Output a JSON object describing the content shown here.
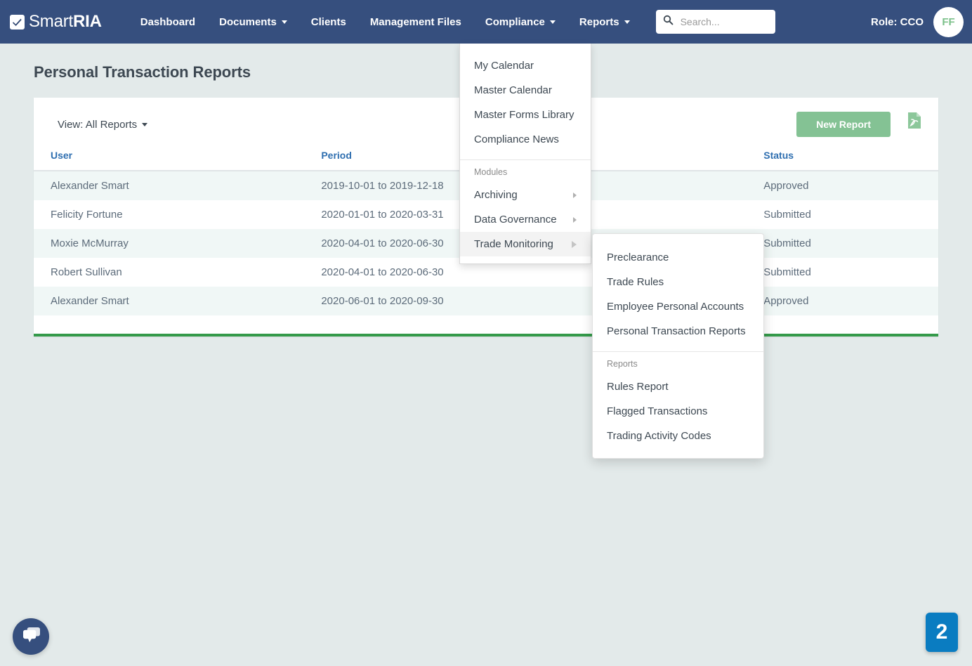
{
  "navbar": {
    "brand": {
      "thin": "Smart",
      "bold": "RIA",
      "icon": "checkbox-check-icon"
    },
    "items": [
      {
        "label": "Dashboard",
        "has_caret": false,
        "name": "nav-link-dashboard"
      },
      {
        "label": "Documents",
        "has_caret": true,
        "name": "nav-link-documents"
      },
      {
        "label": "Clients",
        "has_caret": false,
        "name": "nav-link-clients"
      },
      {
        "label": "Management Files",
        "has_caret": false,
        "name": "nav-link-management-files"
      },
      {
        "label": "Compliance",
        "has_caret": true,
        "name": "nav-link-compliance"
      },
      {
        "label": "Reports",
        "has_caret": true,
        "name": "nav-link-reports"
      }
    ],
    "search": {
      "placeholder": "Search...",
      "value": "",
      "icon": "search-icon"
    },
    "role": "Role: CCO",
    "avatar_initials": "FF"
  },
  "compliance_menu": {
    "items": [
      {
        "label": "My Calendar"
      },
      {
        "label": "Master Calendar"
      },
      {
        "label": "Master Forms Library"
      },
      {
        "label": "Compliance News"
      }
    ],
    "modules_header": "Modules",
    "modules": [
      {
        "label": "Archiving",
        "submenu": true,
        "active": false
      },
      {
        "label": "Data Governance",
        "submenu": true,
        "active": false
      },
      {
        "label": "Trade Monitoring",
        "submenu": true,
        "active": true
      }
    ]
  },
  "trade_submenu": {
    "items": [
      {
        "label": "Preclearance"
      },
      {
        "label": "Trade Rules"
      },
      {
        "label": "Employee Personal Accounts"
      },
      {
        "label": "Personal Transaction Reports"
      }
    ],
    "reports_header": "Reports",
    "reports": [
      {
        "label": "Rules Report"
      },
      {
        "label": "Flagged Transactions"
      },
      {
        "label": "Trading Activity Codes"
      }
    ]
  },
  "page": {
    "title": "Personal Transaction Reports"
  },
  "toolbar": {
    "view_label": "View: All Reports",
    "new_report_label": "New Report",
    "pdf_export_icon": "pdf-file-icon"
  },
  "table": {
    "columns": [
      "User",
      "Period",
      "",
      "Status"
    ],
    "rows": [
      {
        "user": "Alexander Smart",
        "period": "2019-10-01 to 2019-12-18",
        "filler": "",
        "status": "Approved"
      },
      {
        "user": "Felicity Fortune",
        "period": "2020-01-01 to 2020-03-31",
        "filler": "",
        "status": "Submitted"
      },
      {
        "user": "Moxie McMurray",
        "period": "2020-04-01 to 2020-06-30",
        "filler": "",
        "status": "Submitted"
      },
      {
        "user": "Robert Sullivan",
        "period": "2020-04-01 to 2020-06-30",
        "filler": "",
        "status": "Submitted"
      },
      {
        "user": "Alexander Smart",
        "period": "2020-06-01 to 2020-09-30",
        "filler": "",
        "status": "Approved"
      }
    ]
  },
  "widgets": {
    "chat_icon": "chat-bubbles-icon",
    "step_badge": "2"
  },
  "colors": {
    "navbar": "#364f7e",
    "page_bg": "#e3eaea",
    "accent_green": "#84c294",
    "card_underline": "#349a4a",
    "link_blue": "#2f6fb0",
    "badge_blue": "#0a7cc1",
    "row_alt": "#f0f7f6"
  }
}
